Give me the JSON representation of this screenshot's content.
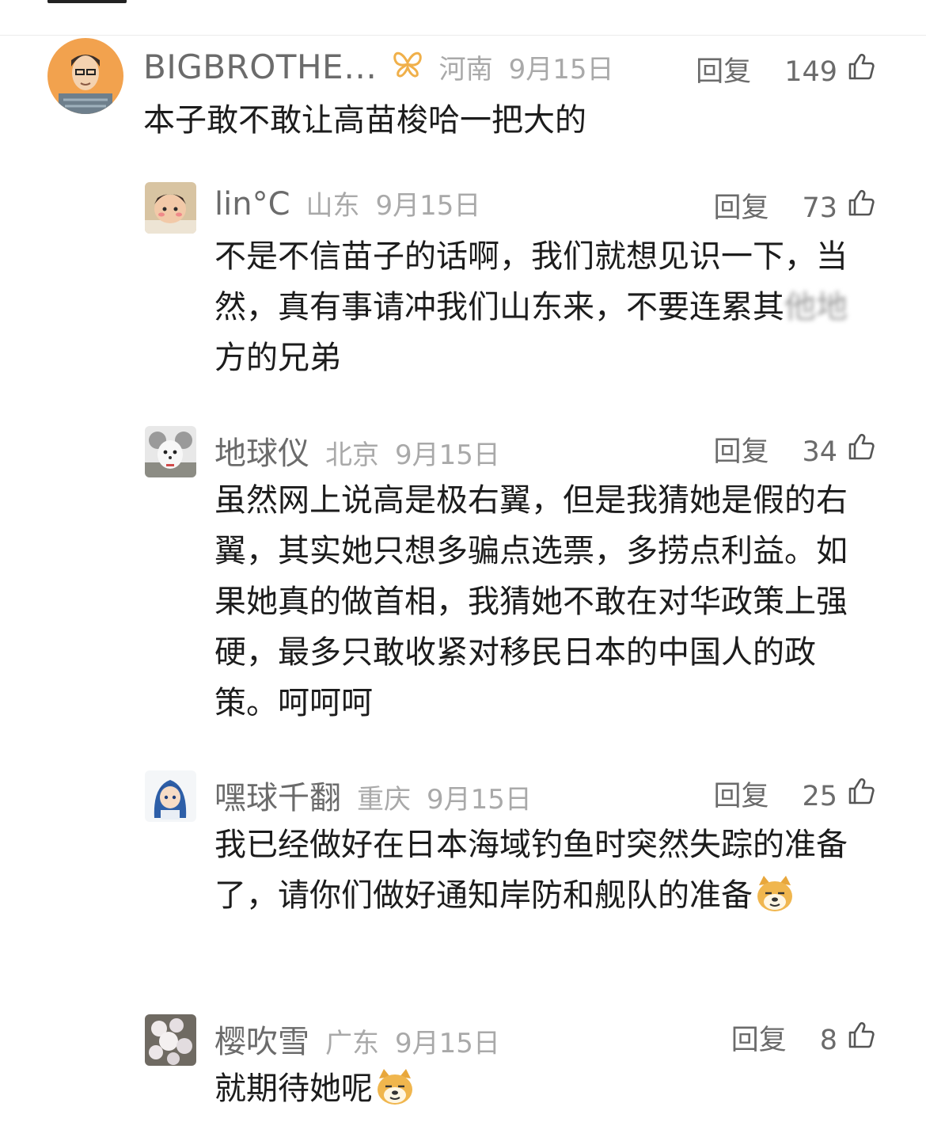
{
  "comments": [
    {
      "username": "BIGBROTHE…",
      "location": "河南",
      "date": "9月15日",
      "reply_label": "回复",
      "likes": "149",
      "text": "本子敢不敢让高苗梭哈一把大的"
    },
    {
      "username": "lin°C",
      "location": "山东",
      "date": "9月15日",
      "reply_label": "回复",
      "likes": "73",
      "text_before_blur": "不是不信苗子的话啊，我们就想见识一下，当然，真有事请冲我们山东来，不要连累其",
      "text_blurred": "他地",
      "text_after_blur": "方的兄弟"
    },
    {
      "username": "地球仪",
      "location": "北京",
      "date": "9月15日",
      "reply_label": "回复",
      "likes": "34",
      "text": "虽然网上说高是极右翼，但是我猜她是假的右翼，其实她只想多骗点选票，多捞点利益。如果她真的做首相，我猜她不敢在对华政策上强硬，最多只敢收紧对移民日本的中国人的政策。呵呵呵"
    },
    {
      "username": "嘿球千翻",
      "location": "重庆",
      "date": "9月15日",
      "reply_label": "回复",
      "likes": "25",
      "text": "我已经做好在日本海域钓鱼时突然失踪的准备了，请你们做好通知岸防和舰队的准备",
      "emoji": "doge-emoji"
    },
    {
      "username": "樱吹雪",
      "location": "广东",
      "date": "9月15日",
      "reply_label": "回复",
      "likes": "8",
      "text": "就期待她呢",
      "emoji": "doge-emoji"
    }
  ],
  "icons": {
    "like": "thumb-up-icon",
    "vip_badge": "butterfly-badge-icon"
  },
  "colors": {
    "username": "#6b6b6b",
    "meta": "#a9a9a9",
    "text": "#1c1c1c",
    "badge": "#f0b04a"
  }
}
